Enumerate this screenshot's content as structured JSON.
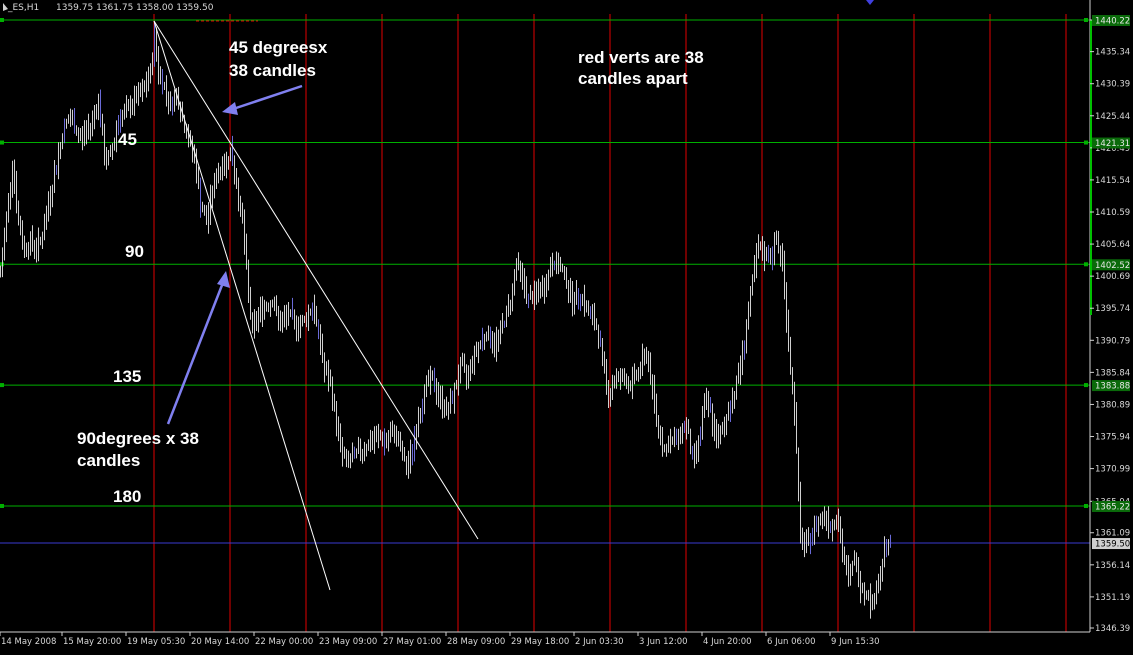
{
  "chart_header": {
    "symbol_timeframe": "_ES,H1",
    "ohlc": "1359.75 1361.75 1358.00 1359.50"
  },
  "colors": {
    "background": "#000000",
    "grid_horizontal": "#00b000",
    "grid_vertical": "#e00000",
    "candles": "#d0d0d0",
    "bid_line": "#3a3ad0",
    "arrow": "#8080f0",
    "trend_line": "#ffffff"
  },
  "chart_data": {
    "type": "line",
    "title": "",
    "ylim": [
      1344.0,
      1443.0
    ],
    "y_ticks": [
      "1346.39",
      "1351.19",
      "1356.14",
      "1361.09",
      "1365.94",
      "1370.99",
      "1375.94",
      "1380.89",
      "1385.84",
      "1390.79",
      "1395.74",
      "1400.69",
      "1405.64",
      "1410.59",
      "1415.54",
      "1420.49",
      "1425.44",
      "1430.39",
      "1435.34",
      "1440.22"
    ],
    "y_tick_values": [
      1346.39,
      1351.19,
      1356.14,
      1361.09,
      1365.94,
      1370.99,
      1375.94,
      1380.89,
      1385.84,
      1390.79,
      1395.74,
      1400.69,
      1405.64,
      1410.59,
      1415.54,
      1420.49,
      1425.44,
      1430.39,
      1435.34,
      1440.22
    ],
    "x_range": [
      0,
      1090
    ],
    "x_ticks": [
      "14 May 2008",
      "15 May 20:00",
      "19 May 05:30",
      "20 May 14:00",
      "22 May 00:00",
      "23 May 09:00",
      "27 May 01:00",
      "28 May 09:00",
      "29 May 18:00",
      "2 Jun 03:30",
      "3 Jun 12:00",
      "4 Jun 20:00",
      "6 Jun 06:00",
      "9 Jun 15:30"
    ],
    "x_tick_bars": [
      0,
      62,
      126,
      190,
      254,
      318,
      382,
      446,
      510,
      574,
      638,
      702,
      766,
      830
    ],
    "horizontal_levels": [
      {
        "value": 1440.22,
        "label": "1440.22",
        "kind": "green"
      },
      {
        "value": 1421.31,
        "label": "1421.31",
        "kind": "green"
      },
      {
        "value": 1402.52,
        "label": "1402.52",
        "kind": "green"
      },
      {
        "value": 1383.88,
        "label": "1383.88",
        "kind": "green"
      },
      {
        "value": 1365.22,
        "label": "1365.22",
        "kind": "green"
      },
      {
        "value": 1359.5,
        "label": "1359.50",
        "kind": "bid"
      }
    ],
    "vertical_bars": [
      154,
      230,
      306,
      382,
      458,
      534,
      610,
      686,
      762,
      838,
      914,
      990,
      1066
    ],
    "price_series": [
      [
        0,
        1401
      ],
      [
        6,
        1410
      ],
      [
        12,
        1418
      ],
      [
        18,
        1409
      ],
      [
        24,
        1405
      ],
      [
        30,
        1406
      ],
      [
        36,
        1405
      ],
      [
        42,
        1407
      ],
      [
        48,
        1412
      ],
      [
        56,
        1418
      ],
      [
        64,
        1424
      ],
      [
        70,
        1425
      ],
      [
        80,
        1422
      ],
      [
        90,
        1424
      ],
      [
        98,
        1428
      ],
      [
        104,
        1419
      ],
      [
        110,
        1419
      ],
      [
        118,
        1425
      ],
      [
        126,
        1426
      ],
      [
        134,
        1428
      ],
      [
        142,
        1429
      ],
      [
        150,
        1432
      ],
      [
        154,
        1438
      ],
      [
        158,
        1432
      ],
      [
        164,
        1430
      ],
      [
        170,
        1427
      ],
      [
        176,
        1429
      ],
      [
        182,
        1425
      ],
      [
        188,
        1422
      ],
      [
        194,
        1419
      ],
      [
        200,
        1412
      ],
      [
        206,
        1409
      ],
      [
        212,
        1414
      ],
      [
        218,
        1417
      ],
      [
        224,
        1418
      ],
      [
        230,
        1420
      ],
      [
        236,
        1415
      ],
      [
        242,
        1409
      ],
      [
        248,
        1398
      ],
      [
        252,
        1392
      ],
      [
        258,
        1395
      ],
      [
        264,
        1396
      ],
      [
        272,
        1397
      ],
      [
        280,
        1393
      ],
      [
        288,
        1395
      ],
      [
        296,
        1393
      ],
      [
        304,
        1394
      ],
      [
        312,
        1396
      ],
      [
        318,
        1392
      ],
      [
        324,
        1386
      ],
      [
        330,
        1384
      ],
      [
        336,
        1378
      ],
      [
        342,
        1373
      ],
      [
        348,
        1372
      ],
      [
        354,
        1373
      ],
      [
        362,
        1374
      ],
      [
        370,
        1375
      ],
      [
        378,
        1376
      ],
      [
        386,
        1375
      ],
      [
        394,
        1377
      ],
      [
        400,
        1374
      ],
      [
        406,
        1371
      ],
      [
        412,
        1374
      ],
      [
        418,
        1379
      ],
      [
        424,
        1383
      ],
      [
        430,
        1385
      ],
      [
        436,
        1383
      ],
      [
        442,
        1381
      ],
      [
        448,
        1380
      ],
      [
        454,
        1383
      ],
      [
        460,
        1387
      ],
      [
        466,
        1385
      ],
      [
        472,
        1388
      ],
      [
        478,
        1390
      ],
      [
        486,
        1392
      ],
      [
        494,
        1390
      ],
      [
        502,
        1393
      ],
      [
        510,
        1397
      ],
      [
        516,
        1403
      ],
      [
        522,
        1400
      ],
      [
        528,
        1397
      ],
      [
        536,
        1398
      ],
      [
        544,
        1399
      ],
      [
        552,
        1403
      ],
      [
        560,
        1402
      ],
      [
        566,
        1400
      ],
      [
        572,
        1397
      ],
      [
        580,
        1398
      ],
      [
        588,
        1395
      ],
      [
        596,
        1393
      ],
      [
        602,
        1388
      ],
      [
        608,
        1382
      ],
      [
        614,
        1385
      ],
      [
        622,
        1385
      ],
      [
        630,
        1384
      ],
      [
        638,
        1386
      ],
      [
        646,
        1389
      ],
      [
        652,
        1383
      ],
      [
        658,
        1377
      ],
      [
        664,
        1374
      ],
      [
        670,
        1375
      ],
      [
        678,
        1376
      ],
      [
        686,
        1378
      ],
      [
        692,
        1372
      ],
      [
        698,
        1375
      ],
      [
        704,
        1381
      ],
      [
        710,
        1380
      ],
      [
        716,
        1375
      ],
      [
        722,
        1377
      ],
      [
        728,
        1380
      ],
      [
        734,
        1383
      ],
      [
        740,
        1387
      ],
      [
        746,
        1393
      ],
      [
        752,
        1400
      ],
      [
        758,
        1405
      ],
      [
        764,
        1404
      ],
      [
        770,
        1404
      ],
      [
        776,
        1406
      ],
      [
        782,
        1403
      ],
      [
        788,
        1390
      ],
      [
        794,
        1380
      ],
      [
        800,
        1360
      ],
      [
        806,
        1359
      ],
      [
        812,
        1361
      ],
      [
        818,
        1363
      ],
      [
        824,
        1364
      ],
      [
        830,
        1362
      ],
      [
        836,
        1364
      ],
      [
        842,
        1358
      ],
      [
        848,
        1354
      ],
      [
        854,
        1357
      ],
      [
        860,
        1353
      ],
      [
        866,
        1352
      ],
      [
        872,
        1350
      ],
      [
        878,
        1354
      ],
      [
        884,
        1358
      ],
      [
        890,
        1359.5
      ]
    ]
  },
  "annotations": {
    "label_45deg_line1": "45 degreesx",
    "label_45deg_line2": "38 candles",
    "label_red_line1": "red verts are 38",
    "label_red_line2": "candles apart",
    "label_90deg_line1": "90degrees x 38",
    "label_90deg_line2": "candles",
    "level_45": "45",
    "level_90": "90",
    "level_135": "135",
    "level_180": "180"
  }
}
